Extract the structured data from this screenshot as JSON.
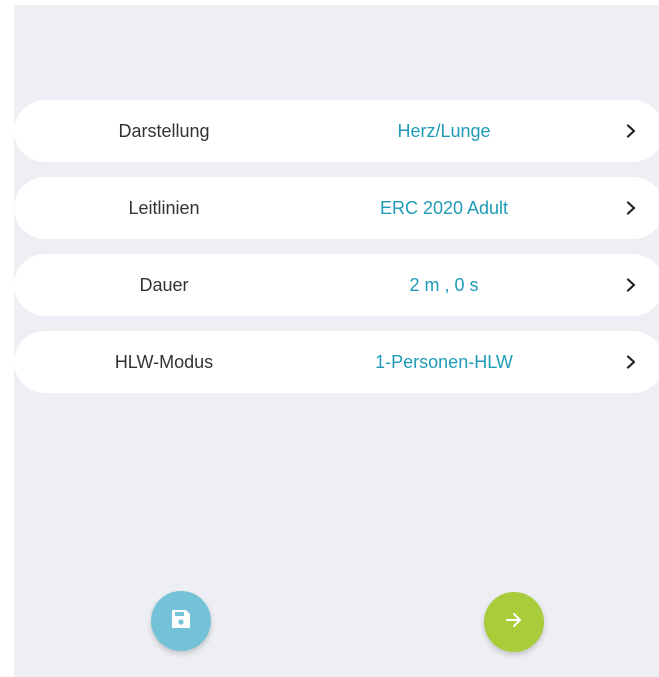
{
  "settings": {
    "items": [
      {
        "label": "Darstellung",
        "value": "Herz/Lunge"
      },
      {
        "label": "Leitlinien",
        "value": "ERC 2020 Adult"
      },
      {
        "label": "Dauer",
        "value": "2 m , 0 s"
      },
      {
        "label": "HLW-Modus",
        "value": "1-Personen-HLW"
      }
    ]
  },
  "icons": {
    "row_action": "chevron-right-icon",
    "save": "save-icon",
    "next": "arrow-right-icon"
  },
  "colors": {
    "background": "#eeeff4",
    "row_background": "#ffffff",
    "label_text": "#333333",
    "value_text": "#1f9bb8",
    "save_button": "#74c2d7",
    "next_button": "#a8cc3a"
  }
}
